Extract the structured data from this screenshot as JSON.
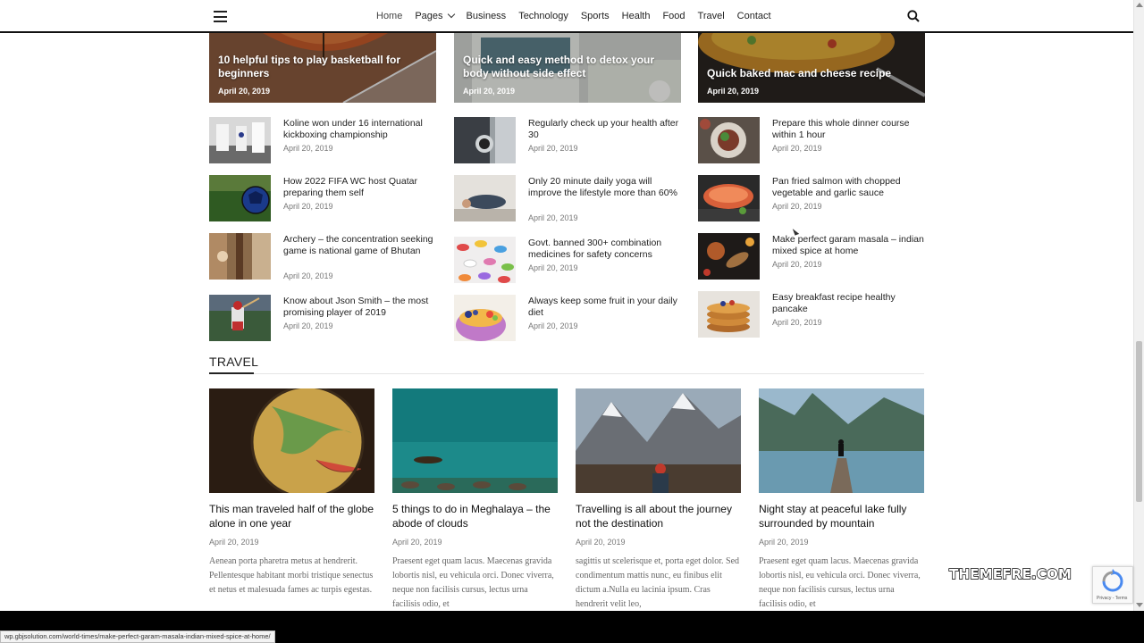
{
  "nav": {
    "items": [
      {
        "label": "Home"
      },
      {
        "label": "Pages"
      },
      {
        "label": "Business"
      },
      {
        "label": "Technology"
      },
      {
        "label": "Sports"
      },
      {
        "label": "Health"
      },
      {
        "label": "Food"
      },
      {
        "label": "Travel"
      },
      {
        "label": "Contact"
      }
    ],
    "menu_icon": "hamburger-icon",
    "search_icon": "search-icon"
  },
  "featured": [
    {
      "title": "10 helpful tips to play basketball for beginners",
      "date": "April 20, 2019"
    },
    {
      "title": "Quick and easy method to detox your body without side effect",
      "date": "April 20, 2019"
    },
    {
      "title": "Quick baked mac and cheese recipe",
      "date": "April 20, 2019"
    }
  ],
  "columns": [
    [
      {
        "title": "Koline won under 16 international kickboxing championship",
        "date": "April 20, 2019"
      },
      {
        "title": "How 2022 FIFA WC host Quatar preparing them self",
        "date": "April 20, 2019"
      },
      {
        "title": "Archery – the concentration seeking game is national game of Bhutan",
        "date": "April 20, 2019"
      },
      {
        "title": "Know about Json Smith – the most promising player of 2019",
        "date": "April 20, 2019"
      }
    ],
    [
      {
        "title": "Regularly check up your health after 30",
        "date": "April 20, 2019"
      },
      {
        "title": "Only 20 minute daily yoga will improve the lifestyle more than 60%",
        "date": "April 20, 2019"
      },
      {
        "title": "Govt. banned 300+ combination medicines for safety concerns",
        "date": "April 20, 2019"
      },
      {
        "title": "Always keep some fruit in your daily diet",
        "date": "April 20, 2019"
      }
    ],
    [
      {
        "title": "Prepare this whole dinner course within 1 hour",
        "date": "April 20, 2019"
      },
      {
        "title": "Pan fried salmon with chopped vegetable and garlic sauce",
        "date": "April 20, 2019"
      },
      {
        "title": "Make perfect garam masala – indian mixed spice at home",
        "date": "April 20, 2019"
      },
      {
        "title": "Easy breakfast recipe healthy pancake",
        "date": "April 20, 2019"
      }
    ]
  ],
  "travel": {
    "heading": "TRAVEL",
    "posts": [
      {
        "title": "This man traveled half of the globe alone in one year",
        "date": "April 20, 2019",
        "excerpt": "Aenean porta pharetra metus at hendrerit. Pellentesque habitant morbi tristique senectus et netus et malesuada fames ac turpis egestas."
      },
      {
        "title": "5 things to do in Meghalaya – the abode of clouds",
        "date": "April 20, 2019",
        "excerpt": "Praesent eget quam lacus. Maecenas gravida lobortis nisl, eu vehicula orci. Donec viverra, neque non facilisis cursus, lectus urna facilisis odio, et"
      },
      {
        "title": "Travelling is all about the journey not the destination",
        "date": "April 20, 2019",
        "excerpt": "sagittis ut scelerisque et, porta eget dolor. Sed condimentum mattis nunc, eu finibus elit dictum a.Nulla eu lacinia ipsum. Cras hendrerit velit leo,"
      },
      {
        "title": "Night stay at peaceful lake fully surrounded by mountain",
        "date": "April 20, 2019",
        "excerpt": "Praesent eget quam lacus. Maecenas gravida lobortis nisl, eu vehicula orci. Donec viverra, neque non facilisis cursus, lectus urna facilisis odio, et"
      }
    ]
  },
  "status_url": "wp.gbjsolution.com/world-times/make-perfect-garam-masala-indian-mixed-spice-at-home/",
  "watermark": "THEMEFRE.COM",
  "recaptcha_text": "Privacy - Terms"
}
